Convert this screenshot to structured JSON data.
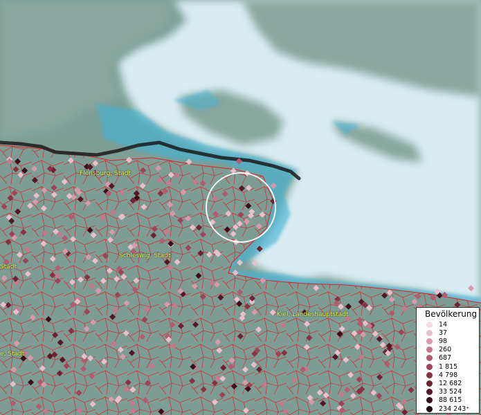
{
  "labels": {
    "flensburg": "Flensburg, Stadt",
    "schleswig": "Schleswig, Stadt",
    "kiel": "Kiel, Landeshauptstadt",
    "left_stadt": "Stadt",
    "left_stadt2": "e, Stadt"
  },
  "legend": {
    "title": "Bevölkerung",
    "items": [
      {
        "value": "14",
        "color": "#f4dde4"
      },
      {
        "value": "37",
        "color": "#e8bfcb"
      },
      {
        "value": "98",
        "color": "#d79aaa"
      },
      {
        "value": "260",
        "color": "#c6788c"
      },
      {
        "value": "687",
        "color": "#b35b70"
      },
      {
        "value": "1 815",
        "color": "#9f4458"
      },
      {
        "value": "4 798",
        "color": "#883244"
      },
      {
        "value": "12 682",
        "color": "#6e2233"
      },
      {
        "value": "33 524",
        "color": "#551726"
      },
      {
        "value": "88 615",
        "color": "#3b0f1a"
      },
      {
        "value": "234 243⁺",
        "color": "#200810"
      }
    ]
  },
  "colors": {
    "water": "#d9edf3",
    "land_north": "#8aa9a0",
    "coast": "#4fb6d6",
    "border_line": "#1a1a1a",
    "polygon": "#e0202a"
  }
}
